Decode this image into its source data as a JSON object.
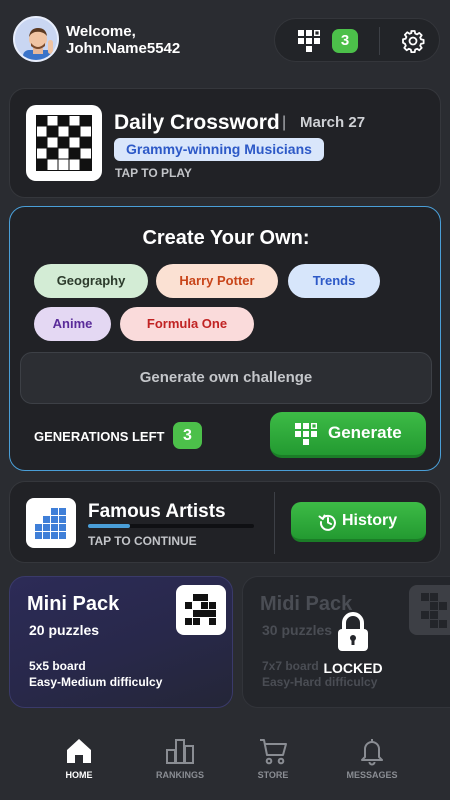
{
  "header": {
    "welcome_line1": "Welcome,",
    "username": "John.Name5542",
    "puzzle_count": "3"
  },
  "daily": {
    "title": "Daily Crossword",
    "separator": "|",
    "date": "March 27",
    "topic": "Grammy-winning Musicians",
    "tap": "TAP TO PLAY"
  },
  "create": {
    "title": "Create Your Own:",
    "chips": [
      "Geography",
      "Harry Potter",
      "Trends",
      "Anime",
      "Formula One"
    ],
    "input_placeholder": "Generate own challenge",
    "generations_left_label": "GENERATIONS LEFT",
    "generations_left_count": "3",
    "generate_label": "Generate"
  },
  "continue": {
    "title": "Famous Artists",
    "progress": 0.25,
    "tap": "TAP TO CONTINUE",
    "history_label": "History"
  },
  "packs": [
    {
      "title": "Mini Pack",
      "count": "20 puzzles",
      "board": "5x5 board",
      "difficulty": "Easy-Medium difficulcy"
    },
    {
      "title": "Midi Pack",
      "count": "30 puzzles",
      "board": "7x7 board",
      "difficulty": "Easy-Hard difficulcy",
      "locked_label": "LOCKED"
    }
  ],
  "nav": [
    {
      "label": "HOME",
      "icon": "home-icon",
      "active": true
    },
    {
      "label": "RANKINGS",
      "icon": "rankings-icon",
      "active": false
    },
    {
      "label": "STORE",
      "icon": "cart-icon",
      "active": false
    },
    {
      "label": "MESSAGES",
      "icon": "bell-icon",
      "active": false
    }
  ],
  "colors": {
    "accent_green": "#3dbb46",
    "accent_blue": "#4a9fd8",
    "background": "#2a2c31",
    "card": "#212226"
  }
}
